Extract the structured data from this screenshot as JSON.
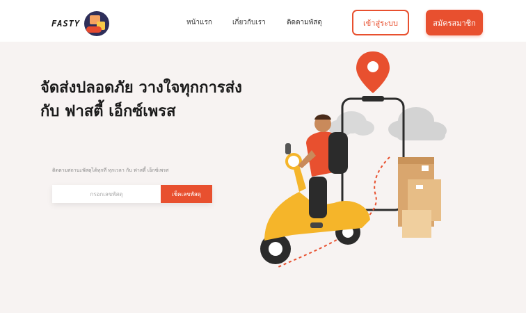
{
  "header": {
    "logo_text": "FASTY",
    "nav": [
      {
        "label": "หน้าแรก"
      },
      {
        "label": "เกี่ยวกับเรา"
      },
      {
        "label": "ติดตามพัสดุ"
      }
    ],
    "login_label": "เข้าสู่ระบบ",
    "register_label": "สมัครสมาชิก"
  },
  "hero": {
    "headline_line1": "จัดส่งปลอดภัย วางใจทุกการส่ง",
    "headline_line2": "กับ ฟาสตี้ เอ็กซ์เพรส",
    "subtext": "ติดตามสถานะพัสดุได้ทุกที่ ทุกเวลา กับ ฟาสตี้ เอ็กซ์เพรส",
    "track_placeholder": "กรอกเลขพัสดุ",
    "track_button": "เช็คเลขพัสดุ"
  },
  "colors": {
    "accent": "#e8502f",
    "hero_bg": "#f7f3f2"
  }
}
